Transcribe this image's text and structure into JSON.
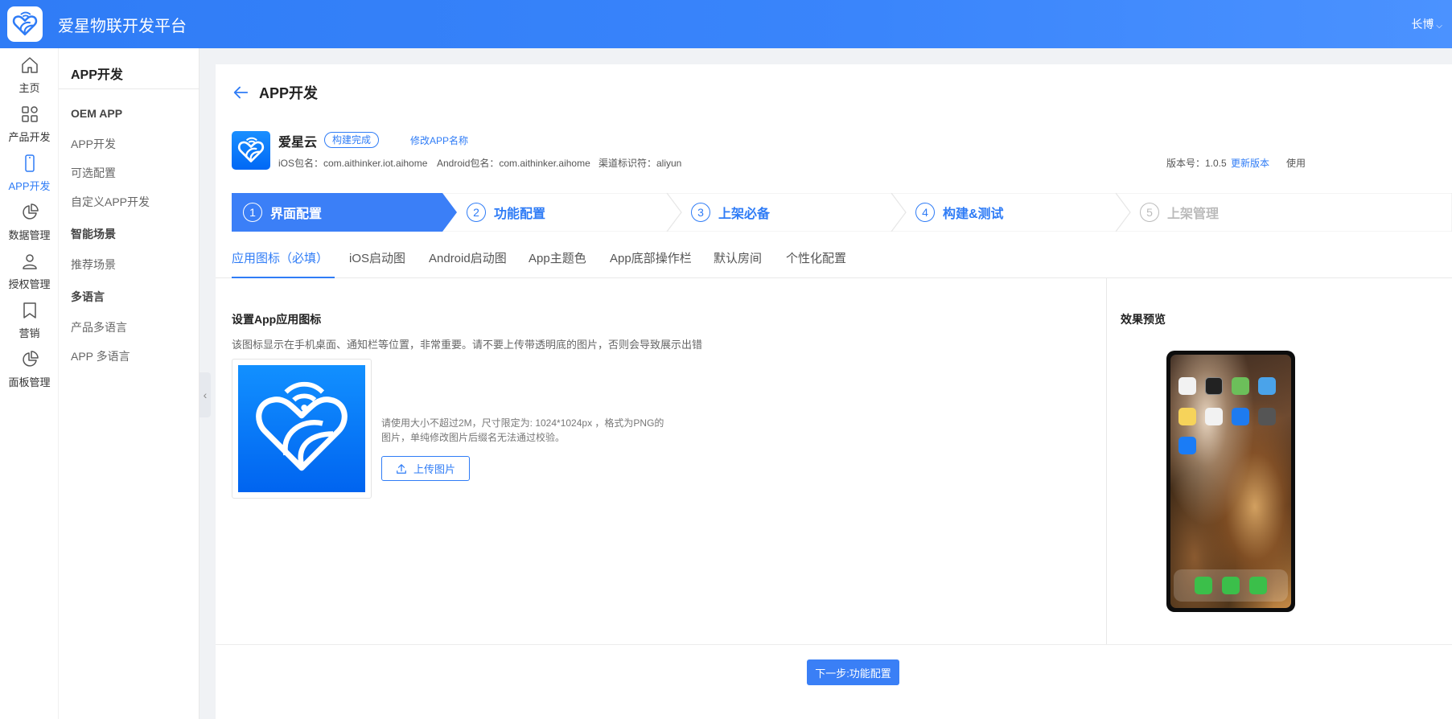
{
  "topbar": {
    "title": "爱星物联开发平台",
    "user": "长博"
  },
  "rail": [
    {
      "label": "主页",
      "icon": "home-icon"
    },
    {
      "label": "产品开发",
      "icon": "grid-icon"
    },
    {
      "label": "APP开发",
      "icon": "phone-icon",
      "active": true
    },
    {
      "label": "数据管理",
      "icon": "pie-chart-icon"
    },
    {
      "label": "授权管理",
      "icon": "user-icon"
    },
    {
      "label": "营销",
      "icon": "bookmark-icon"
    },
    {
      "label": "面板管理",
      "icon": "pie-chart-icon"
    }
  ],
  "subnav": {
    "title": "APP开发",
    "groups": [
      {
        "label": "OEM APP",
        "items": [
          "APP开发",
          "可选配置",
          "自定义APP开发"
        ]
      },
      {
        "label": "智能场景",
        "items": [
          "推荐场景"
        ]
      },
      {
        "label": "多语言",
        "items": [
          "产品多语言",
          "APP 多语言"
        ]
      }
    ]
  },
  "page": {
    "title": "APP开发",
    "app": {
      "name": "爱星云",
      "status": "构建完成",
      "rename": "修改APP名称",
      "ios_package": "iOS包名：com.aithinker.iot.aihome",
      "android_package": "Android包名：com.aithinker.aihome",
      "channel": "渠道标识符：aliyun",
      "version": "版本号：1.0.5",
      "update_version": "更新版本",
      "usage_truncated": "使用"
    },
    "steps": [
      {
        "num": "1",
        "label": "界面配置",
        "state": "active"
      },
      {
        "num": "2",
        "label": "功能配置",
        "state": "pending"
      },
      {
        "num": "3",
        "label": "上架必备",
        "state": "pending"
      },
      {
        "num": "4",
        "label": "构建&测试",
        "state": "pending"
      },
      {
        "num": "5",
        "label": "上架管理",
        "state": "disabled"
      }
    ],
    "tabs": [
      "应用图标（必填）",
      "iOS启动图",
      "Android启动图",
      "App主题色",
      "App底部操作栏",
      "默认房间",
      "个性化配置"
    ],
    "section": {
      "title": "设置App应用图标",
      "desc": "该图标显示在手机桌面、通知栏等位置，非常重要。请不要上传带透明底的图片，否则会导致展示出错",
      "hint": "请使用大小不超过2M，尺寸限定为: 1024*1024px ，格式为PNG的图片，单纯修改图片后缀名无法通过校验。",
      "upload": "上传图片"
    },
    "preview": {
      "title": "效果预览"
    },
    "next_button": "下一步:功能配置"
  },
  "colors": {
    "primary": "#2f7cf6",
    "active_step": "#3b7ff7",
    "pending_step": "#2f7cf6",
    "disabled_step": "#bbbbbb"
  }
}
